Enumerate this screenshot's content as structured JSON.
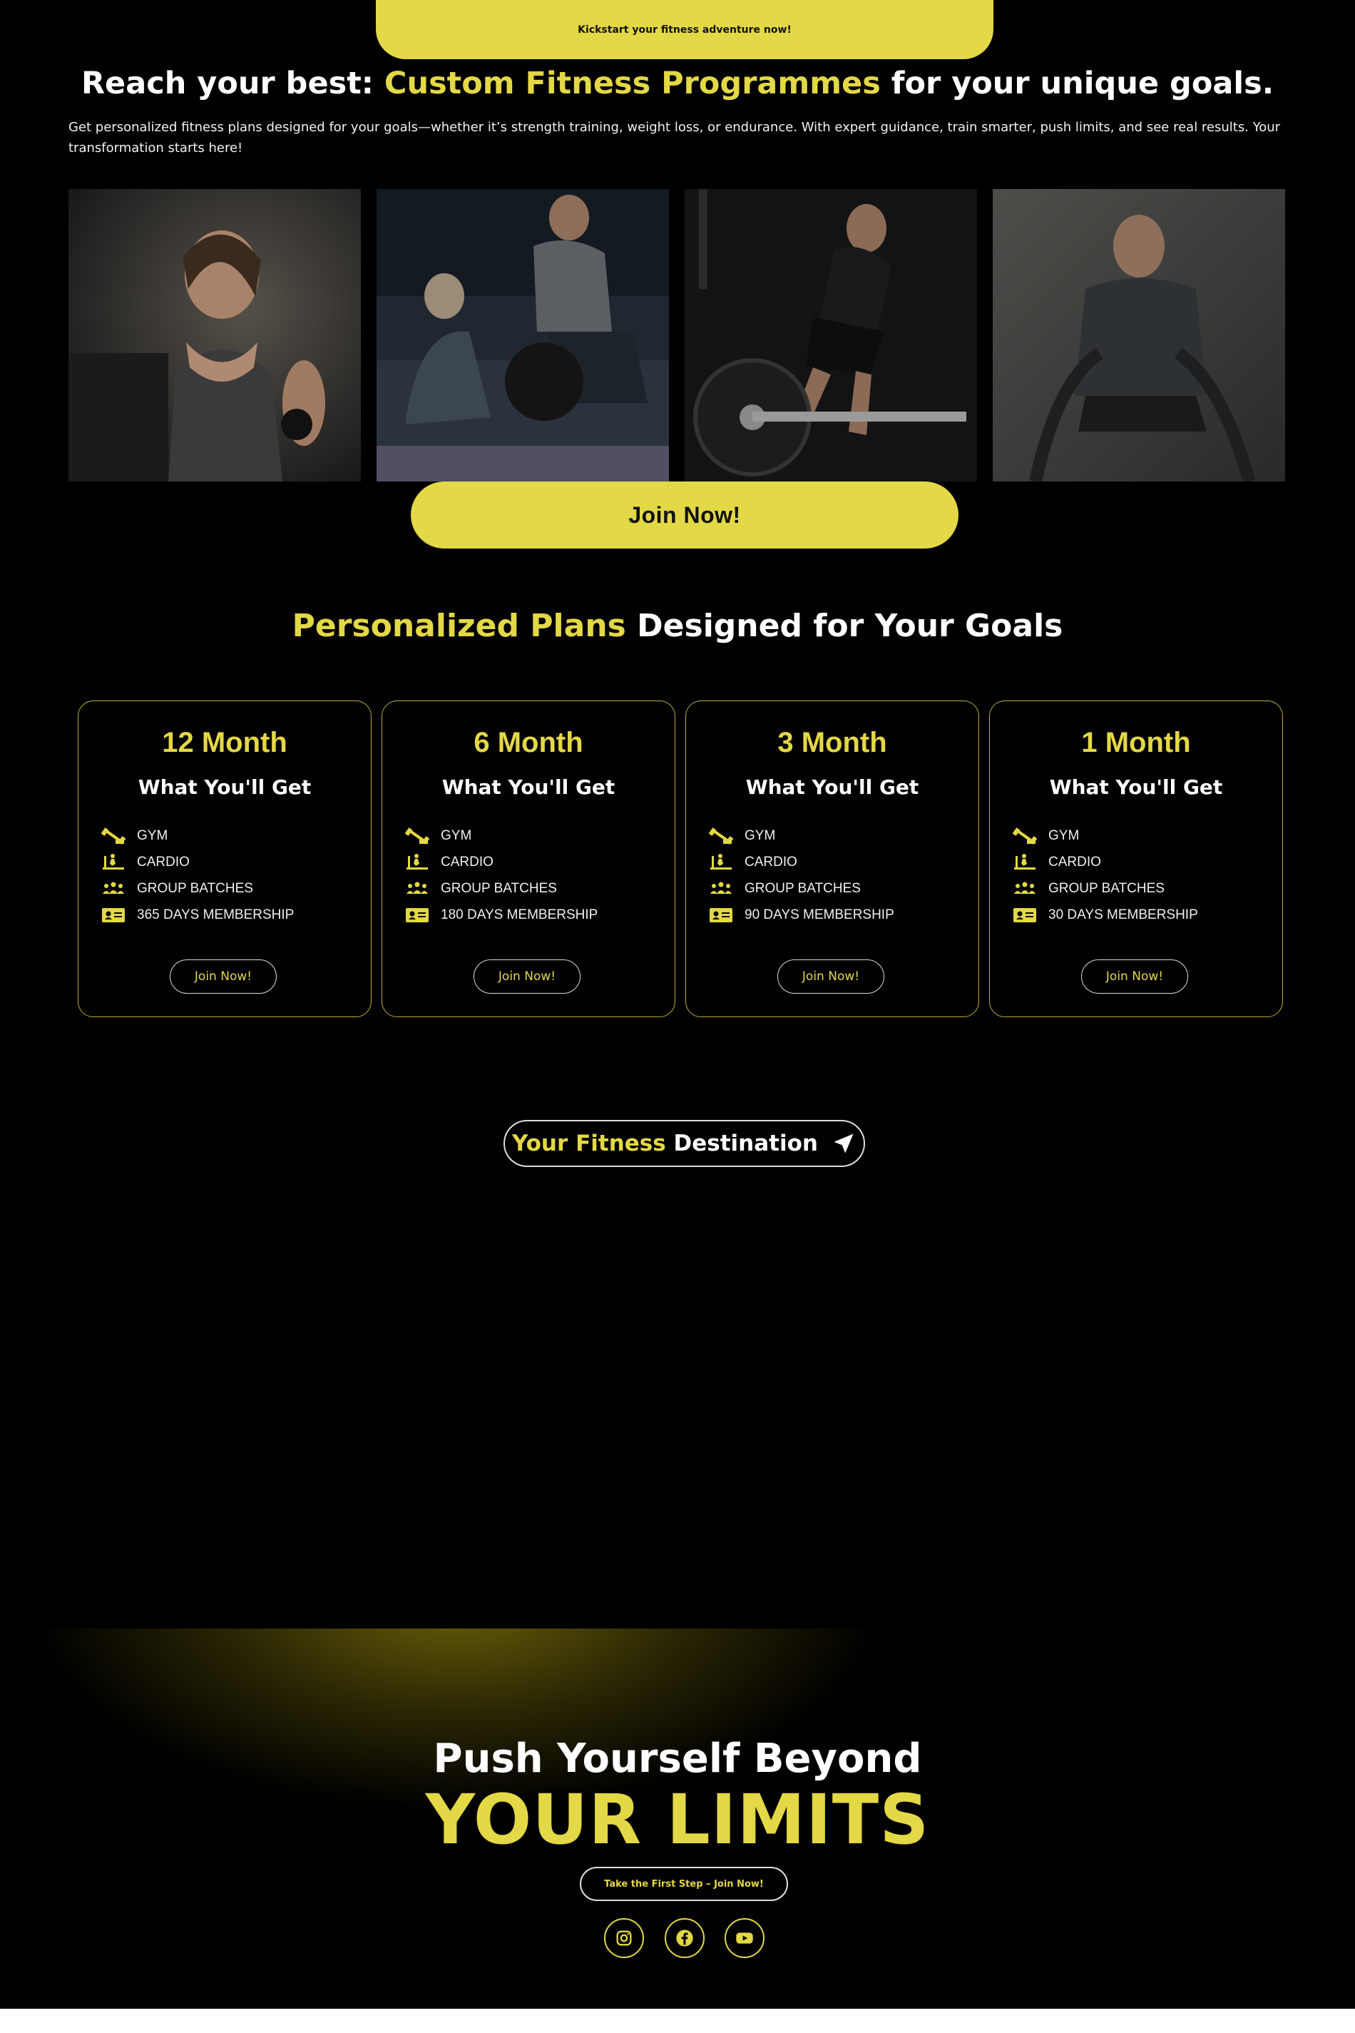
{
  "top_banner": {
    "text": "Kickstart your fitness adventure now!"
  },
  "hero": {
    "title_pre": "Reach your best: ",
    "title_highlight": "Custom Fitness Programmes",
    "title_post": " for your unique goals.",
    "description": "Get personalized fitness plans designed for your goals—whether it’s strength training, weight loss, or endurance. With expert guidance, train smarter, push limits, and see real results. Your transformation starts here!"
  },
  "join_button": "Join Now!",
  "plans_section": {
    "title_highlight": "Personalized Plans",
    "title_rest": " Designed for Your Goals",
    "what_label": "What You'll Get",
    "button_label": "Join Now!",
    "plans": [
      {
        "duration": "12 Month",
        "features": [
          "GYM",
          "CARDIO",
          "GROUP BATCHES",
          "365 DAYS MEMBERSHIP"
        ]
      },
      {
        "duration": "6 Month",
        "features": [
          "GYM",
          "CARDIO",
          "GROUP BATCHES",
          "180 DAYS MEMBERSHIP"
        ]
      },
      {
        "duration": "3 Month",
        "features": [
          "GYM",
          "CARDIO",
          "GROUP BATCHES",
          "90 DAYS MEMBERSHIP"
        ]
      },
      {
        "duration": "1 Month",
        "features": [
          "GYM",
          "CARDIO",
          "GROUP BATCHES",
          "30 DAYS MEMBERSHIP"
        ]
      }
    ],
    "feature_icons": [
      "dumbbell-icon",
      "treadmill-icon",
      "group-icon",
      "id-card-icon"
    ]
  },
  "destination": {
    "highlight": "Your Fitness",
    "rest": " Destination",
    "icon": "navigation-arrow-icon"
  },
  "cta": {
    "line1": "Push Yourself Beyond",
    "line2": "YOUR LIMITS",
    "button": "Take the First Step – Join Now!"
  },
  "social": [
    "instagram-icon",
    "facebook-icon",
    "youtube-icon"
  ],
  "colors": {
    "accent": "#e3d845",
    "background": "#000000",
    "text": "#ffffff"
  }
}
